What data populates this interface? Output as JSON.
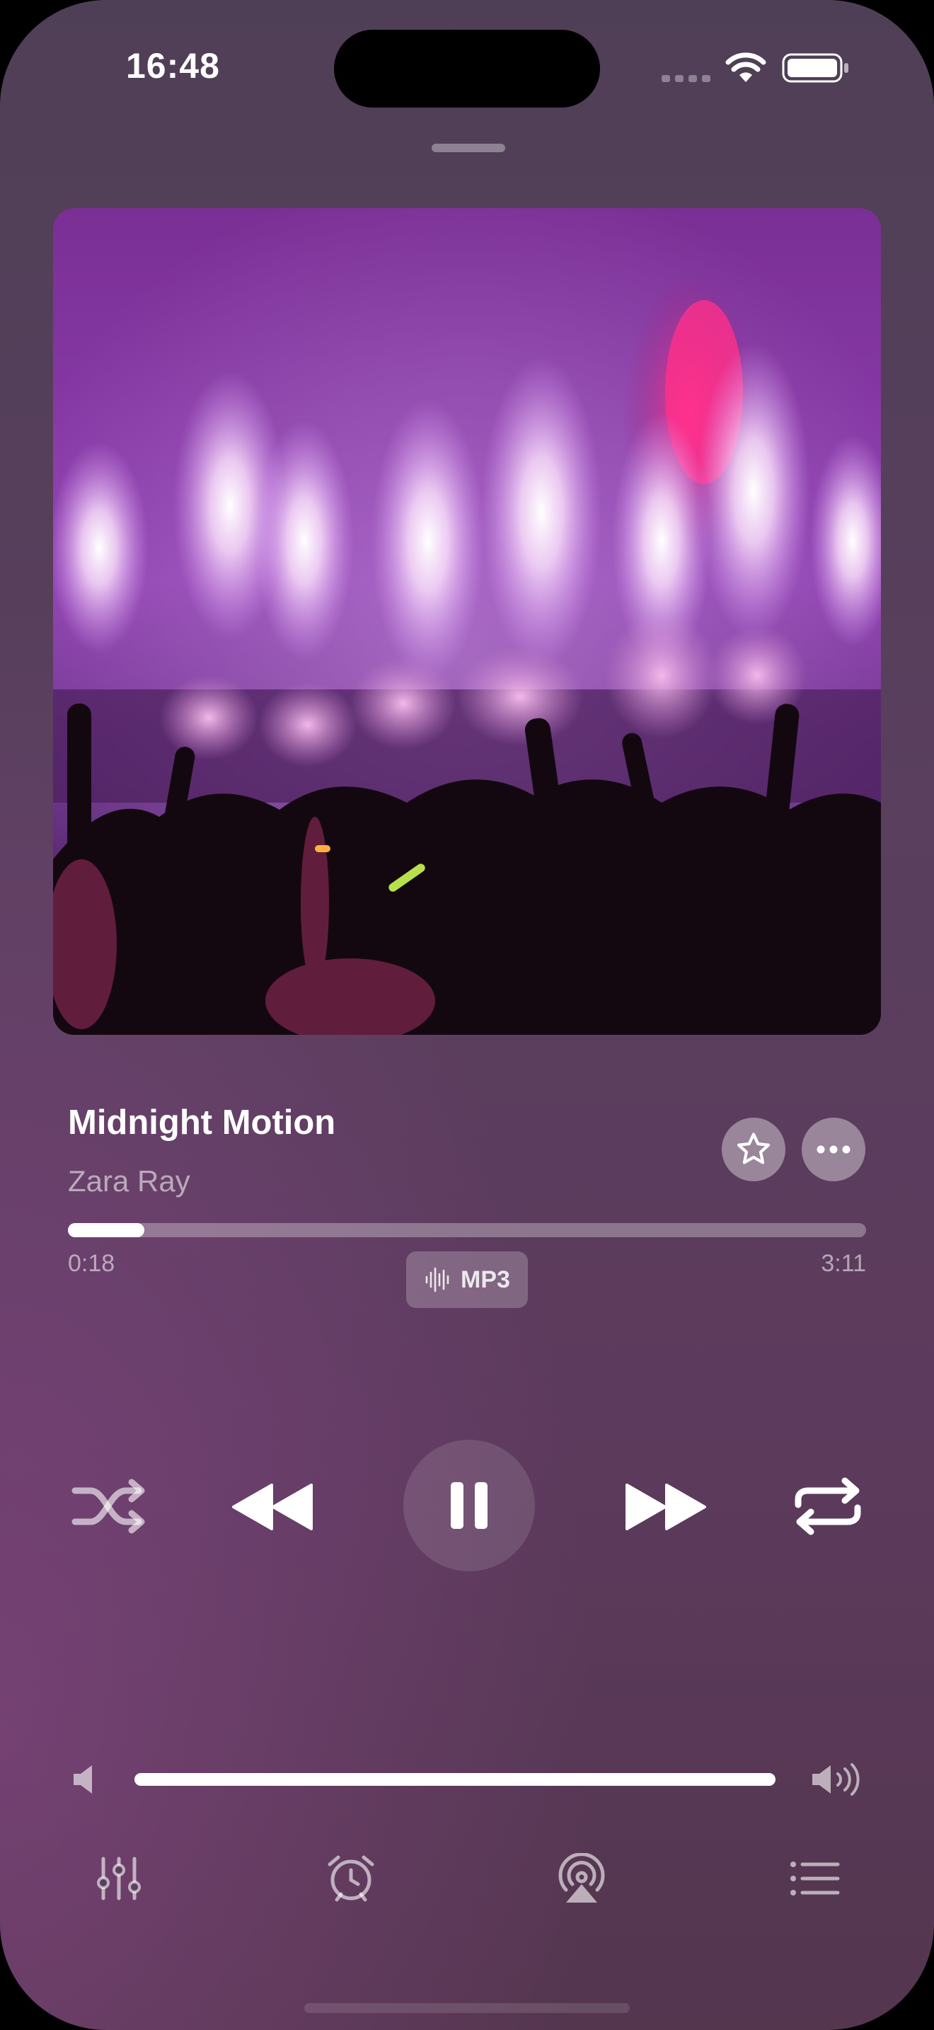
{
  "status_bar": {
    "time": "16:48"
  },
  "track": {
    "title": "Midnight Motion",
    "artist": "Zara Ray",
    "elapsed": "0:18",
    "duration": "3:11",
    "progress_fraction": 0.096,
    "format": "MP3"
  },
  "volume": {
    "level_fraction": 1.0
  },
  "controls": [
    "shuffle-icon",
    "rewind-icon",
    "pause-icon",
    "fast-forward-icon",
    "repeat-icon"
  ],
  "toolbar": [
    "equalizer-icon",
    "alarm-clock-icon",
    "airplay-icon",
    "queue-list-icon"
  ],
  "colors": {
    "accent": "#ffffff",
    "background": "#553a58"
  }
}
